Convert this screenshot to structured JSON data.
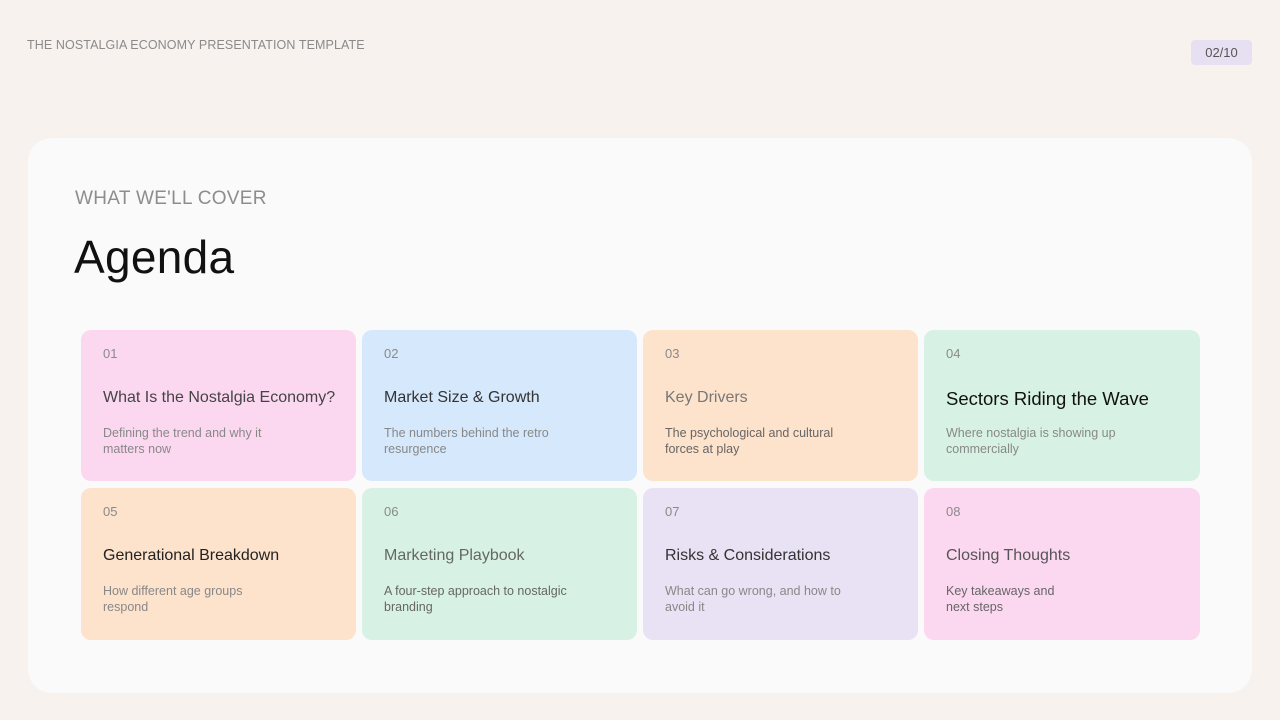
{
  "header": {
    "title": "THE NOSTALGIA ECONOMY PRESENTATION TEMPLATE",
    "page_indicator": "02/10"
  },
  "slide": {
    "eyebrow": "WHAT WE'LL COVER",
    "heading": "Agenda"
  },
  "colors": {
    "pink": "#fcd8f0",
    "blue": "#d6e8fc",
    "peach": "#fde2cc",
    "mint": "#d7f2e4",
    "lavender": "#e9e1f4"
  },
  "agenda": [
    {
      "num": "01",
      "title": "What Is the Nostalgia Economy?",
      "desc": "Defining the trend and why it matters now",
      "color": "#fcd8f0"
    },
    {
      "num": "02",
      "title": "Market Size & Growth",
      "desc": "The numbers behind the retro resurgence",
      "color": "#d6e8fc"
    },
    {
      "num": "03",
      "title": "Key Drivers",
      "desc": "The psychological and cultural forces at play",
      "color": "#fde2cc"
    },
    {
      "num": "04",
      "title": "Sectors Riding the Wave",
      "desc": "Where nostalgia is showing up commercially",
      "color": "#d7f2e4"
    },
    {
      "num": "05",
      "title": "Generational Breakdown",
      "desc": "How different age groups respond",
      "color": "#fde2cc"
    },
    {
      "num": "06",
      "title": "Marketing Playbook",
      "desc": "A four-step approach to nostalgic branding",
      "color": "#d7f2e4"
    },
    {
      "num": "07",
      "title": "Risks & Considerations",
      "desc": "What can go wrong, and how to avoid it",
      "color": "#e9e1f4"
    },
    {
      "num": "08",
      "title": "Closing Thoughts",
      "desc": "Key takeaways and next steps",
      "color": "#fcd8f0"
    }
  ]
}
